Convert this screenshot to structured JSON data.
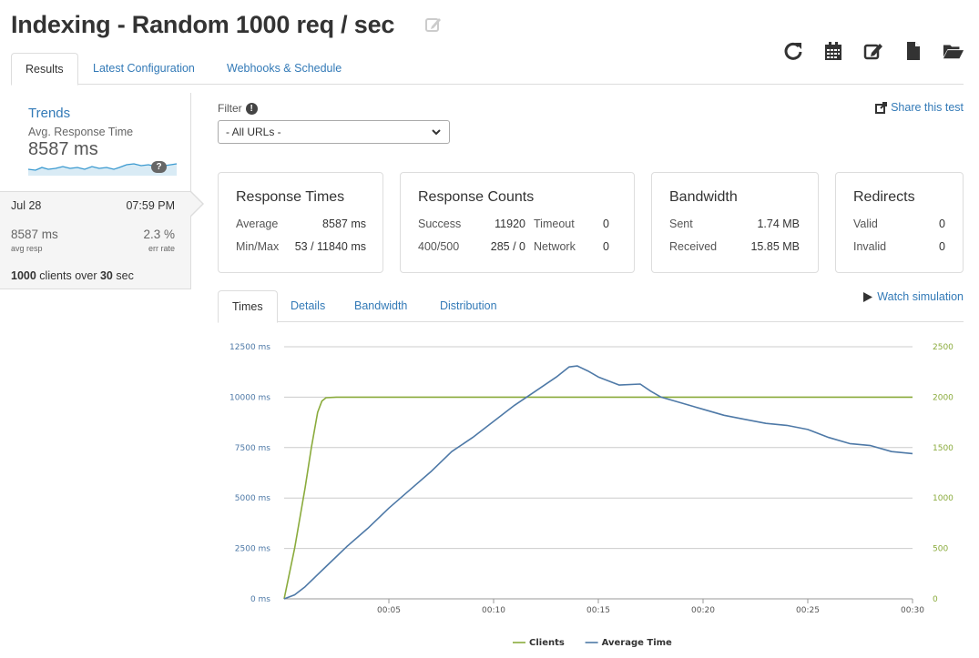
{
  "page": {
    "title": "Indexing - Random 1000 req / sec"
  },
  "toolbar": {
    "icons": [
      "refresh-icon",
      "calendar-icon",
      "edit-icon",
      "file-icon",
      "folder-open-icon"
    ]
  },
  "tabs": [
    "Results",
    "Latest Configuration",
    "Webhooks & Schedule"
  ],
  "trends": {
    "title": "Trends",
    "subtitle": "Avg. Response Time",
    "value": "8587 ms",
    "help_glyph": "?",
    "date": "Jul 28",
    "time": "07:59 PM",
    "avg_resp": "8587 ms",
    "avg_resp_label": "avg resp",
    "err_rate": "2.3 %",
    "err_rate_label": "err rate",
    "clients_summary": {
      "clients": "1000",
      "clients_text": " clients over ",
      "duration": "30",
      "duration_text": " sec"
    }
  },
  "filter": {
    "label": "Filter",
    "info_glyph": "!",
    "selected": "- All URLs -"
  },
  "share_label": "Share this test",
  "cards": {
    "response_times": {
      "title": "Response Times",
      "rows": [
        {
          "label": "Average",
          "value": "8587 ms"
        },
        {
          "label": "Min/Max",
          "value": "53 / 11840 ms"
        }
      ]
    },
    "response_counts": {
      "title": "Response Counts",
      "rows": [
        {
          "label": "Success",
          "value": "11920",
          "label2": "Timeout",
          "value2": "0"
        },
        {
          "label": "400/500",
          "value": "285 / 0",
          "label2": "Network",
          "value2": "0"
        }
      ]
    },
    "bandwidth": {
      "title": "Bandwidth",
      "rows": [
        {
          "label": "Sent",
          "value": "1.74 MB"
        },
        {
          "label": "Received",
          "value": "15.85 MB"
        }
      ]
    },
    "redirects": {
      "title": "Redirects",
      "rows": [
        {
          "label": "Valid",
          "value": "0"
        },
        {
          "label": "Invalid",
          "value": "0"
        }
      ]
    }
  },
  "watch_simulation": "Watch simulation",
  "chart_tabs": [
    "Times",
    "Details",
    "Bandwidth",
    "Distribution"
  ],
  "chart_data": {
    "type": "line",
    "x_ticks": [
      "00:05",
      "00:10",
      "00:15",
      "00:20",
      "00:25",
      "00:30"
    ],
    "x_tick_values": [
      5,
      10,
      15,
      20,
      25,
      30
    ],
    "xlim": [
      0,
      30
    ],
    "y_left_ticks": [
      "0 ms",
      "2500 ms",
      "5000 ms",
      "7500 ms",
      "10000 ms",
      "12500 ms"
    ],
    "y_left_values": [
      0,
      2500,
      5000,
      7500,
      10000,
      12500
    ],
    "y_left_lim": [
      0,
      12500
    ],
    "y_right_ticks": [
      "0",
      "500",
      "1000",
      "1500",
      "2000",
      "2500"
    ],
    "y_right_values": [
      0,
      500,
      1000,
      1500,
      2000,
      2500
    ],
    "y_right_lim": [
      0,
      2500
    ],
    "grid": true,
    "legend_position": "bottom",
    "series": [
      {
        "name": "Clients",
        "axis": "right",
        "color": "#8aab3c",
        "x": [
          0,
          0.5,
          1.0,
          1.3,
          1.6,
          1.8,
          2.0,
          2.5,
          3,
          5,
          10,
          15,
          20,
          25,
          30
        ],
        "y": [
          0,
          500,
          1100,
          1500,
          1850,
          1960,
          1995,
          2000,
          2000,
          2000,
          2000,
          2000,
          2000,
          2000,
          2000
        ]
      },
      {
        "name": "Average Time",
        "axis": "left",
        "color": "#4e79a7",
        "x": [
          0,
          0.5,
          1,
          1.5,
          2,
          3,
          4,
          5,
          6,
          7,
          8,
          9,
          10,
          11,
          12,
          13,
          13.6,
          14,
          14.5,
          15,
          16,
          17,
          17.5,
          18,
          19,
          20,
          21,
          22,
          23,
          24,
          25,
          26,
          27,
          28,
          29,
          30
        ],
        "y": [
          0,
          200,
          600,
          1100,
          1600,
          2600,
          3500,
          4500,
          5400,
          6300,
          7300,
          8000,
          8800,
          9600,
          10300,
          11000,
          11500,
          11550,
          11300,
          11000,
          10600,
          10650,
          10300,
          10000,
          9700,
          9400,
          9100,
          8900,
          8700,
          8600,
          8400,
          8000,
          7700,
          7600,
          7300,
          7200
        ]
      }
    ]
  }
}
